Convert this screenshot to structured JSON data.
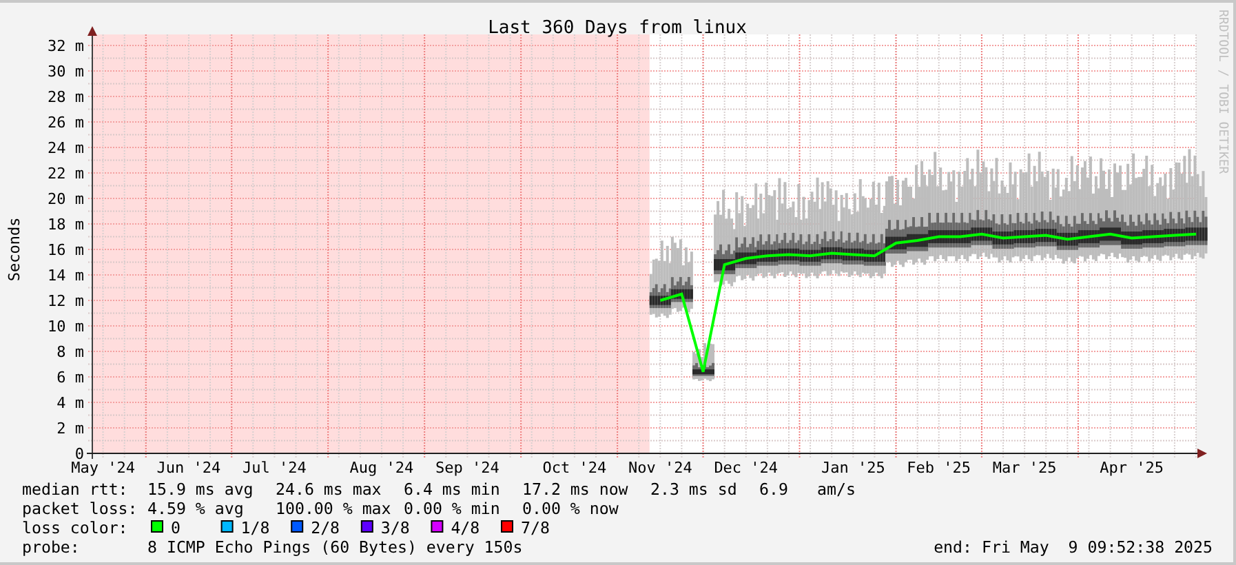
{
  "chart": {
    "credit": "RRDTOOL / TOBI OETIKER",
    "chart_data": {
      "type": "line",
      "title": "Last 360 Days from linux",
      "ylabel": "Seconds",
      "grid": true,
      "categories": [
        "May '24",
        null,
        null,
        null,
        "Jun '24",
        null,
        null,
        null,
        "Jul '24",
        null,
        null,
        null,
        null,
        "Aug '24",
        null,
        null,
        null,
        "Sep '24",
        null,
        null,
        null,
        null,
        "Oct '24",
        null,
        null,
        null,
        "Nov '24",
        null,
        null,
        null,
        "Dec '24",
        null,
        null,
        null,
        null,
        "Jan '25",
        null,
        null,
        null,
        "Feb '25",
        null,
        null,
        null,
        "Mar '25",
        null,
        null,
        null,
        null,
        "Apr '25",
        null,
        null,
        null
      ],
      "ylim": [
        0,
        32
      ],
      "yticks": [
        {
          "value": 0,
          "label": "0"
        },
        {
          "value": 2,
          "label": "2 m"
        },
        {
          "value": 4,
          "label": "4 m"
        },
        {
          "value": 6,
          "label": "6 m"
        },
        {
          "value": 8,
          "label": "8 m"
        },
        {
          "value": 10,
          "label": "10 m"
        },
        {
          "value": 12,
          "label": "12 m"
        },
        {
          "value": 14,
          "label": "14 m"
        },
        {
          "value": 16,
          "label": "16 m"
        },
        {
          "value": 18,
          "label": "18 m"
        },
        {
          "value": 20,
          "label": "20 m"
        },
        {
          "value": 22,
          "label": "22 m"
        },
        {
          "value": 24,
          "label": "24 m"
        },
        {
          "value": 26,
          "label": "26 m"
        },
        {
          "value": 28,
          "label": "28 m"
        },
        {
          "value": 30,
          "label": "30 m"
        },
        {
          "value": 32,
          "label": "32 m"
        }
      ],
      "series": [
        {
          "color": "#00ff00",
          "values": [
            null,
            null,
            null,
            null,
            null,
            null,
            null,
            null,
            null,
            null,
            null,
            null,
            null,
            null,
            null,
            null,
            null,
            null,
            null,
            null,
            null,
            null,
            null,
            null,
            null,
            null,
            12,
            12.5,
            6.4,
            14.8,
            15.3,
            15.5,
            15.6,
            15.5,
            15.7,
            15.6,
            15.5,
            16.5,
            16.7,
            17,
            17,
            17.2,
            16.9,
            17,
            17.1,
            16.8,
            17,
            17.2,
            16.9,
            17,
            17.1,
            17.2
          ]
        }
      ]
    }
  },
  "legend": {
    "median_rtt": {
      "label": "median rtt:",
      "values": [
        "15.9 ms avg",
        "24.6 ms max",
        "6.4 ms min",
        "17.2 ms now",
        "2.3 ms sd",
        "6.9",
        "am/s"
      ]
    },
    "packet_loss": {
      "label": "packet loss:",
      "values": [
        "4.59 % avg",
        "100.00 % max",
        "0.00 % min",
        "0.00 % now"
      ]
    },
    "loss_color": {
      "label": "loss color:",
      "items": [
        {
          "label": "0",
          "color": "#00ff00"
        },
        {
          "label": "1/8",
          "color": "#00b8ff"
        },
        {
          "label": "2/8",
          "color": "#0059ff"
        },
        {
          "label": "3/8",
          "color": "#5e00ff"
        },
        {
          "label": "4/8",
          "color": "#d400ff"
        },
        {
          "label": "7/8",
          "color": "#ff0000"
        }
      ]
    },
    "probe": {
      "label": "probe:",
      "value": "8 ICMP Echo Pings (60 Bytes) every 150s"
    },
    "end": "end: Fri May  9 09:52:38 2025"
  }
}
